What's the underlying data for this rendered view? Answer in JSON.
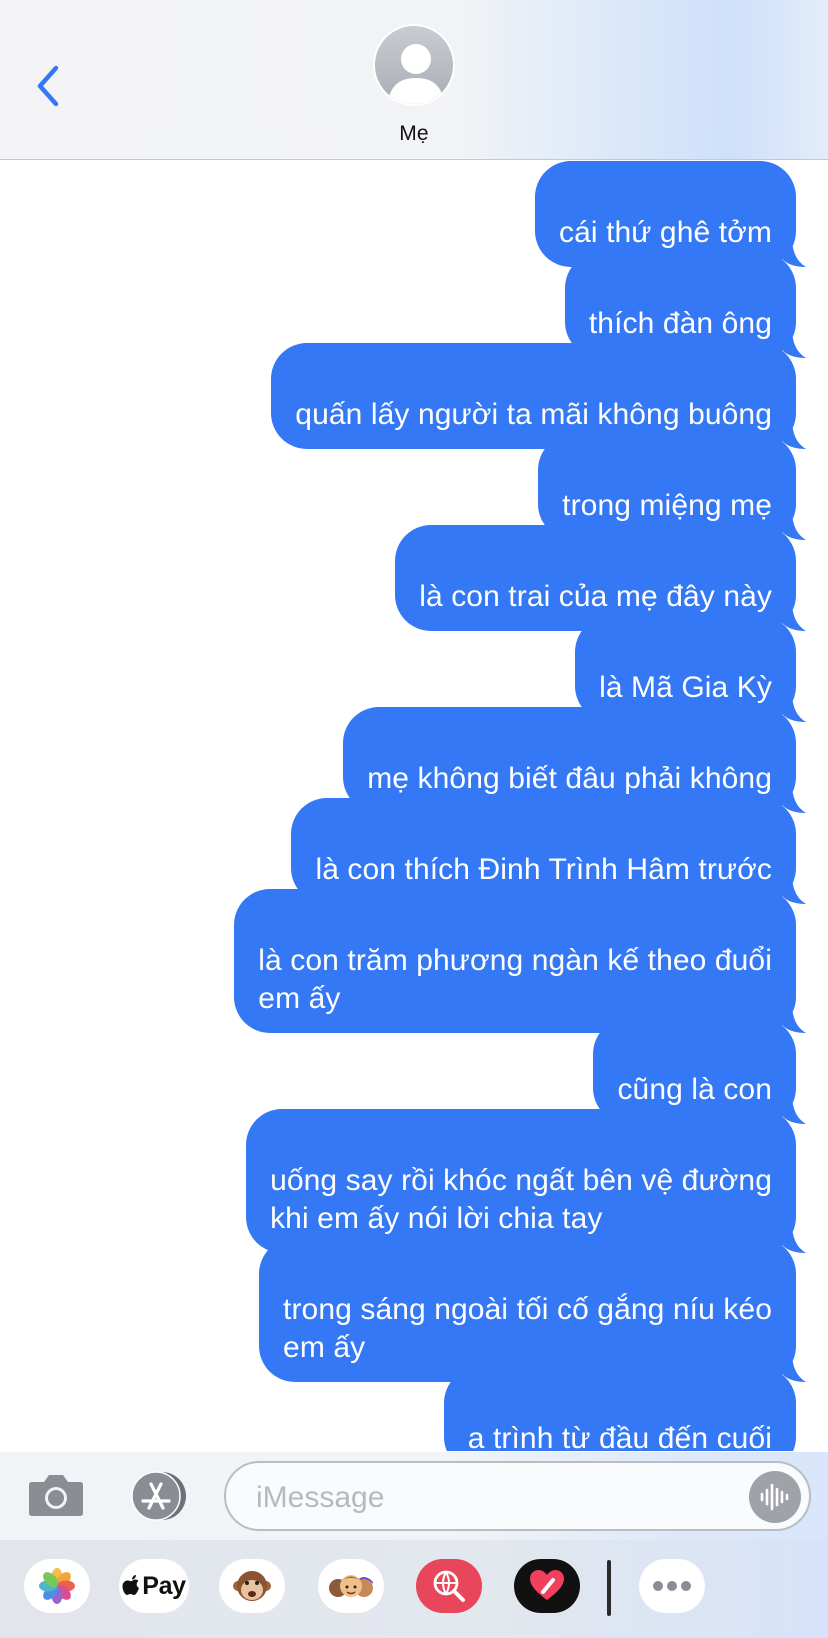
{
  "header": {
    "contact_name": "Mẹ"
  },
  "messages": [
    {
      "text": "cái thứ ghê tởm"
    },
    {
      "text": "thích đàn ông"
    },
    {
      "text": "quấn lấy người ta mãi không buông"
    },
    {
      "text": "trong miệng mẹ"
    },
    {
      "text": "là con trai của mẹ đây này"
    },
    {
      "text": "là Mã Gia Kỳ"
    },
    {
      "text": "mẹ không biết đâu phải không"
    },
    {
      "text": "là con thích Đinh Trình Hâm trước"
    },
    {
      "text": "là con trăm phương ngàn kế theo đuổi\nem ấy"
    },
    {
      "text": "cũng là con"
    },
    {
      "text": "uống say rồi khóc ngất bên vệ đường\nkhi em ấy nói lời chia tay"
    },
    {
      "text": "trong sáng ngoài tối cố gắng níu kéo\nem ấy"
    },
    {
      "text": "a trình từ đầu đến cuối"
    }
  ],
  "input": {
    "placeholder": "iMessage"
  },
  "drawer": {
    "pay_label": "Pay"
  },
  "colors": {
    "bubble_blue": "#3478f6",
    "accent": "#3478f6"
  }
}
